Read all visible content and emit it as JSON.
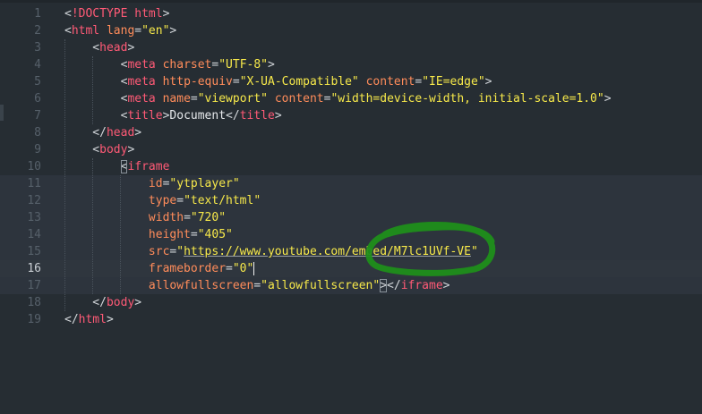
{
  "editor": {
    "active_line": 16,
    "accent_colors": {
      "tag": "#ff5a76",
      "attribute": "#ff8c5a",
      "string": "#f7e94a",
      "annotation": "#1f8f1a"
    },
    "lines": [
      {
        "n": "1",
        "tokens": [
          [
            "t-punct",
            "<"
          ],
          [
            "t-doctype",
            "!DOCTYPE html"
          ],
          [
            "t-punct",
            ">"
          ]
        ]
      },
      {
        "n": "2",
        "tokens": [
          [
            "t-punct",
            "<"
          ],
          [
            "t-tag",
            "html"
          ],
          [
            "t-punct",
            " "
          ],
          [
            "t-attr",
            "lang"
          ],
          [
            "t-eq",
            "="
          ],
          [
            "t-str",
            "\"en\""
          ],
          [
            "t-punct",
            ">"
          ]
        ]
      },
      {
        "n": "3",
        "tokens": [
          [
            "t-punct",
            "    <"
          ],
          [
            "t-tag",
            "head"
          ],
          [
            "t-punct",
            ">"
          ]
        ]
      },
      {
        "n": "4",
        "tokens": [
          [
            "t-punct",
            "        <"
          ],
          [
            "t-tag",
            "meta"
          ],
          [
            "t-punct",
            " "
          ],
          [
            "t-attr",
            "charset"
          ],
          [
            "t-eq",
            "="
          ],
          [
            "t-str",
            "\"UTF-8\""
          ],
          [
            "t-punct",
            ">"
          ]
        ]
      },
      {
        "n": "5",
        "tokens": [
          [
            "t-punct",
            "        <"
          ],
          [
            "t-tag",
            "meta"
          ],
          [
            "t-punct",
            " "
          ],
          [
            "t-attr",
            "http-equiv"
          ],
          [
            "t-eq",
            "="
          ],
          [
            "t-str",
            "\"X-UA-Compatible\""
          ],
          [
            "t-punct",
            " "
          ],
          [
            "t-attr",
            "content"
          ],
          [
            "t-eq",
            "="
          ],
          [
            "t-str",
            "\"IE=edge\""
          ],
          [
            "t-punct",
            ">"
          ]
        ]
      },
      {
        "n": "6",
        "tokens": [
          [
            "t-punct",
            "        <"
          ],
          [
            "t-tag",
            "meta"
          ],
          [
            "t-punct",
            " "
          ],
          [
            "t-attr",
            "name"
          ],
          [
            "t-eq",
            "="
          ],
          [
            "t-str",
            "\"viewport\""
          ],
          [
            "t-punct",
            " "
          ],
          [
            "t-attr",
            "content"
          ],
          [
            "t-eq",
            "="
          ],
          [
            "t-str",
            "\"width=device-width, initial-scale=1.0\""
          ],
          [
            "t-punct",
            ">"
          ]
        ]
      },
      {
        "n": "7",
        "tokens": [
          [
            "t-punct",
            "        <"
          ],
          [
            "t-tag",
            "title"
          ],
          [
            "t-punct",
            ">"
          ],
          [
            "t-text",
            "Document"
          ],
          [
            "t-punct",
            "</"
          ],
          [
            "t-tag",
            "title"
          ],
          [
            "t-punct",
            ">"
          ]
        ]
      },
      {
        "n": "8",
        "tokens": [
          [
            "t-punct",
            "    </"
          ],
          [
            "t-tag",
            "head"
          ],
          [
            "t-punct",
            ">"
          ]
        ]
      },
      {
        "n": "9",
        "tokens": [
          [
            "t-punct",
            "    <"
          ],
          [
            "t-tag",
            "body"
          ],
          [
            "t-punct",
            ">"
          ]
        ]
      },
      {
        "n": "10",
        "tokens": [
          [
            "t-punct",
            "        "
          ],
          [
            "t-punct bracket-box",
            "<"
          ],
          [
            "t-tag",
            "iframe"
          ]
        ]
      },
      {
        "n": "11",
        "tokens": [
          [
            "t-punct",
            "            "
          ],
          [
            "t-attr",
            "id"
          ],
          [
            "t-eq",
            "="
          ],
          [
            "t-str",
            "\"ytplayer\""
          ]
        ]
      },
      {
        "n": "12",
        "tokens": [
          [
            "t-punct",
            "            "
          ],
          [
            "t-attr",
            "type"
          ],
          [
            "t-eq",
            "="
          ],
          [
            "t-str",
            "\"text/html\""
          ]
        ]
      },
      {
        "n": "13",
        "tokens": [
          [
            "t-punct",
            "            "
          ],
          [
            "t-attr",
            "width"
          ],
          [
            "t-eq",
            "="
          ],
          [
            "t-str",
            "\"720\""
          ]
        ]
      },
      {
        "n": "14",
        "tokens": [
          [
            "t-punct",
            "            "
          ],
          [
            "t-attr",
            "height"
          ],
          [
            "t-eq",
            "="
          ],
          [
            "t-str",
            "\"405\""
          ]
        ]
      },
      {
        "n": "15",
        "tokens": [
          [
            "t-punct",
            "            "
          ],
          [
            "t-attr",
            "src"
          ],
          [
            "t-eq",
            "="
          ],
          [
            "t-str",
            "\""
          ],
          [
            "t-str url",
            "https://www.youtube.com/embed/M7lc1UVf-VE"
          ],
          [
            "t-str",
            "\""
          ]
        ]
      },
      {
        "n": "16",
        "tokens": [
          [
            "t-punct",
            "            "
          ],
          [
            "t-attr",
            "frameborder"
          ],
          [
            "t-eq",
            "="
          ],
          [
            "t-str",
            "\"0\""
          ]
        ]
      },
      {
        "n": "17",
        "tokens": [
          [
            "t-punct",
            "            "
          ],
          [
            "t-attr",
            "allowfullscreen"
          ],
          [
            "t-eq",
            "="
          ],
          [
            "t-str",
            "\"allowfullscreen\""
          ],
          [
            "t-punct bracket-box",
            ">"
          ],
          [
            "t-punct",
            "</"
          ],
          [
            "t-tag",
            "iframe"
          ],
          [
            "t-punct",
            ">"
          ]
        ]
      },
      {
        "n": "18",
        "tokens": [
          [
            "t-punct",
            "    </"
          ],
          [
            "t-tag",
            "body"
          ],
          [
            "t-punct",
            ">"
          ]
        ]
      },
      {
        "n": "19",
        "tokens": [
          [
            "t-punct",
            "</"
          ],
          [
            "t-tag",
            "html"
          ],
          [
            "t-punct",
            ">"
          ]
        ]
      }
    ]
  }
}
